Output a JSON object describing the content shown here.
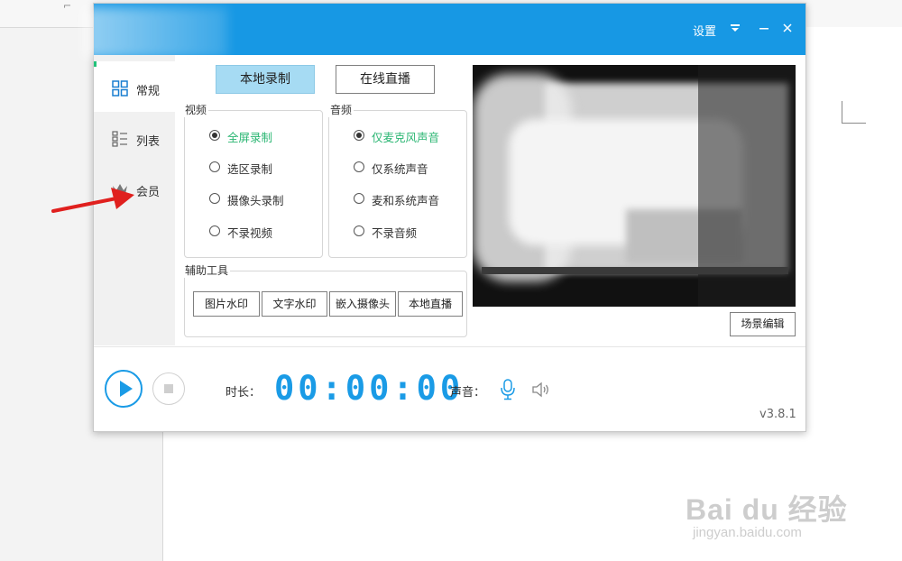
{
  "titlebar": {
    "settings_label": "设置",
    "menu_icon": "menu-icon",
    "minimize_icon": "minimize-icon",
    "close_icon": "close-icon",
    "accent_color": "#1798e4"
  },
  "sidebar": {
    "items": [
      {
        "label": "常规",
        "icon": "grid-icon",
        "active": true
      },
      {
        "label": "列表",
        "icon": "list-icon",
        "active": false
      },
      {
        "label": "会员",
        "icon": "crown-icon",
        "active": false
      }
    ]
  },
  "mode_buttons": {
    "local": "本地录制",
    "online": "在线直播"
  },
  "video": {
    "title": "视频",
    "options": [
      {
        "label": "全屏录制",
        "checked": true
      },
      {
        "label": "选区录制",
        "checked": false
      },
      {
        "label": "摄像头录制",
        "checked": false
      },
      {
        "label": "不录视频",
        "checked": false
      }
    ]
  },
  "audio": {
    "title": "音频",
    "options": [
      {
        "label": "仅麦克风声音",
        "checked": true
      },
      {
        "label": "仅系统声音",
        "checked": false
      },
      {
        "label": "麦和系统声音",
        "checked": false
      },
      {
        "label": "不录音频",
        "checked": false
      }
    ]
  },
  "tools": {
    "title": "辅助工具",
    "buttons": [
      "图片水印",
      "文字水印",
      "嵌入摄像头",
      "本地直播"
    ]
  },
  "scene_button": "场景编辑",
  "bottom": {
    "duration_label": "时长：",
    "timer": "00:00:00",
    "sound_label": "声音：",
    "version": "v3.8.1"
  },
  "watermark": {
    "brand": "Bai du 经验",
    "url": "jingyan.baidu.com"
  }
}
